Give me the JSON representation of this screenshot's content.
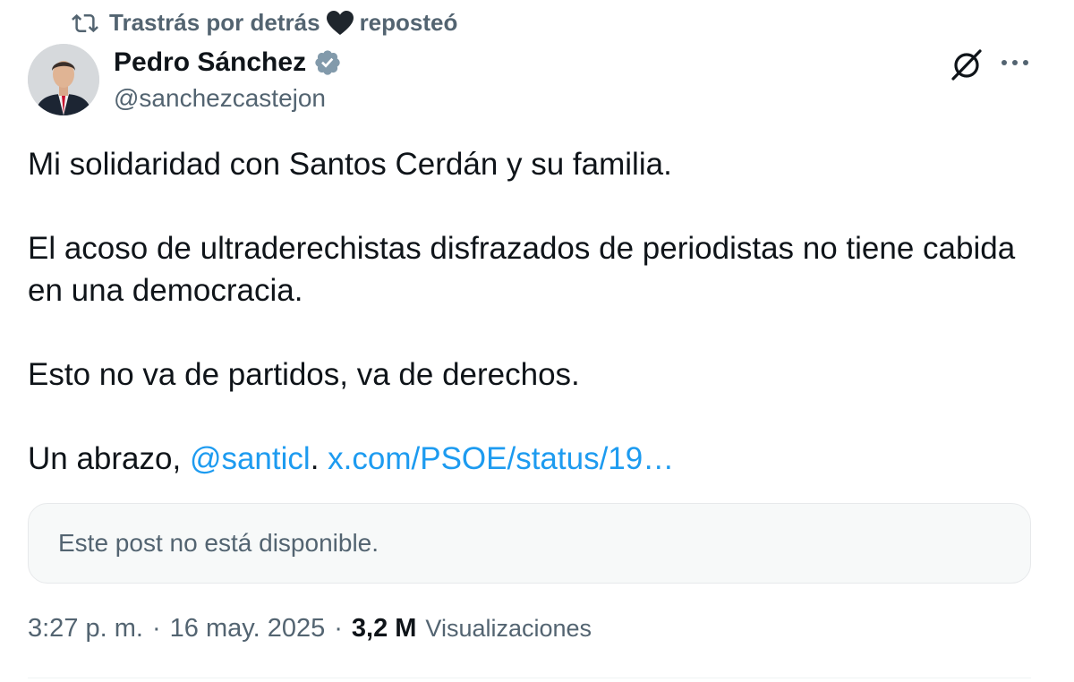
{
  "repost": {
    "user": "Trastrás por detrás",
    "action": "reposteó"
  },
  "author": {
    "name": "Pedro Sánchez",
    "handle": "@sanchezcastejon"
  },
  "tweet": {
    "line1": "Mi solidaridad con Santos Cerdán y su familia.",
    "line2": "El acoso de ultraderechistas disfrazados de periodistas no tiene cabida en una democracia.",
    "line3": "Esto no va de partidos, va de derechos.",
    "line4_prefix": "Un abrazo, ",
    "mention": "@santicl",
    "period": ".",
    "link": "x.com/PSOE/status/19…"
  },
  "quote": {
    "unavailable": "Este post no está disponible."
  },
  "meta": {
    "time": "3:27 p. m.",
    "date": "16 may. 2025",
    "views_count": "3,2 M",
    "views_label": "Visualizaciones",
    "separator": "·"
  },
  "colors": {
    "text": "#0f1419",
    "secondary": "#536471",
    "link": "#1d9bf0",
    "verified": "#829aab"
  }
}
